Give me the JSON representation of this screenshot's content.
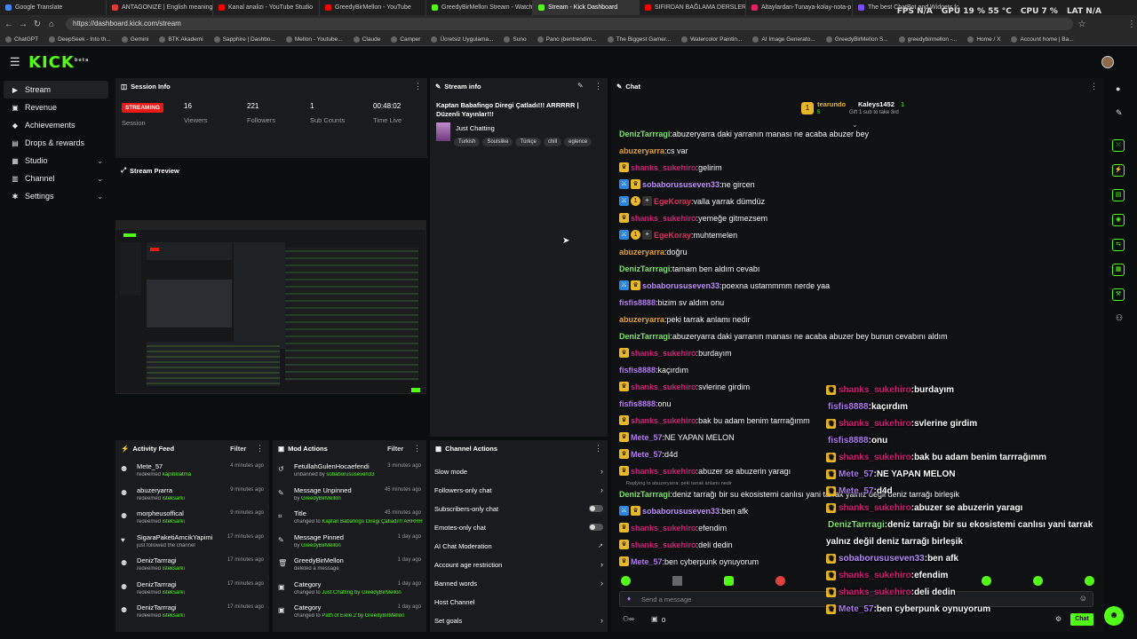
{
  "browser": {
    "tabs": [
      {
        "label": "Google Translate",
        "color": "#4285f4"
      },
      {
        "label": "ANTAGONIZE | English meaning -",
        "color": "#e53935"
      },
      {
        "label": "Kanal analizi - YouTube Studio",
        "color": "#ff0000"
      },
      {
        "label": "GreedyBirMellon - YouTube",
        "color": "#ff0000"
      },
      {
        "label": "GreedyBirMellon Stream - Watch",
        "color": "#53fc18"
      },
      {
        "label": "Stream - Kick Dashboard",
        "color": "#53fc18"
      },
      {
        "label": "SIFIRDAN BAĞLAMA DERSLERİ 6 (",
        "color": "#ff0000"
      },
      {
        "label": "Altaylardan-Tunaya-kolay-nota-p",
        "color": "#e91e63"
      },
      {
        "label": "The best ChatBot and Widgets fo",
        "color": "#7c4dff"
      }
    ],
    "active_tab_index": 5,
    "url": "https://dashboard.kick.com/stream",
    "bookmarks": [
      "ChatGPT",
      "DeepSeek - Into th...",
      "Gemini",
      "BTK Akademi",
      "Sapphire | Dashbo...",
      "Mellon - Youtube...",
      "Claude",
      "Camper",
      "Ücretsiz Uygulama...",
      "Suno",
      "Pano (bentrendim...",
      "The Biggest Gamer...",
      "Watercolor Paintin...",
      "AI Image Generato...",
      "GreedyBirMellon S...",
      "greedybirmellon -...",
      "Home / X",
      "Account home | Ba..."
    ],
    "overlay": {
      "fps": "FPS N/A",
      "gpu": "GPU 19 % 55 °C",
      "cpu": "CPU 7 %",
      "lat": "LAT N/A"
    }
  },
  "app": {
    "logo": "KICK",
    "logo_sup": "beta"
  },
  "sidebar": {
    "items": [
      {
        "label": "Stream",
        "icon": "▶"
      },
      {
        "label": "Revenue",
        "icon": "▣"
      },
      {
        "label": "Achievements",
        "icon": "◆"
      },
      {
        "label": "Drops & rewards",
        "icon": "▤"
      },
      {
        "label": "Studio",
        "icon": "▦"
      },
      {
        "label": "Channel",
        "icon": "▥"
      },
      {
        "label": "Settings",
        "icon": "✱"
      }
    ]
  },
  "session_info": {
    "title": "Session Info",
    "status": "STREAMING",
    "session_label": "Session",
    "stats": [
      {
        "value": "16",
        "label": "Viewers"
      },
      {
        "value": "221",
        "label": "Followers"
      },
      {
        "value": "1",
        "label": "Sub Counts"
      },
      {
        "value": "00:48:02",
        "label": "Time Live"
      }
    ]
  },
  "stream_info": {
    "title": "Stream info",
    "stream_title": "Kaptan Babafingo Diregi Çatladı!!! ARRRRR | Düzenli Yayınlar!!!",
    "category": "Just Chatting",
    "tags": [
      "Turkish",
      "Soulslike",
      "Türkçe",
      "chill",
      "eglence"
    ]
  },
  "preview": {
    "title": "Stream Preview"
  },
  "activity_feed": {
    "title": "Activity Feed",
    "filter": "Filter",
    "items": [
      {
        "name": "Mete_57",
        "action": "redeemed",
        "target": "kapıbklatma",
        "time": "4 minutes ago",
        "icon": "⚉"
      },
      {
        "name": "abuzeryarra",
        "action": "redeemed",
        "target": "isteksarkı",
        "time": "9 minutes ago",
        "icon": "⚉"
      },
      {
        "name": "morpheusoffical",
        "action": "redeemed",
        "target": "isteksarkı",
        "time": "9 minutes ago",
        "icon": "⚉"
      },
      {
        "name": "SigaraPaketiAmcikYapimi",
        "action": "just followed the channel",
        "target": "",
        "time": "17 minutes ago",
        "icon": "♥"
      },
      {
        "name": "DenizTarrragi",
        "action": "redeemed",
        "target": "isteksarkı",
        "time": "17 minutes ago",
        "icon": "⚉"
      },
      {
        "name": "DenizTarrragi",
        "action": "redeemed",
        "target": "isteksarkı",
        "time": "17 minutes ago",
        "icon": "⚉"
      },
      {
        "name": "DenizTarrragi",
        "action": "redeemed",
        "target": "isteksarkı",
        "time": "17 minutes ago",
        "icon": "⚉"
      }
    ]
  },
  "mod_actions": {
    "title": "Mod Actions",
    "filter": "Filter",
    "items": [
      {
        "name": "FetullahGulenHocaefendi",
        "action": "unbanned by",
        "target": "sobaborususeven33",
        "time": "3 minutes ago",
        "icon": "↺"
      },
      {
        "name": "Message Unpinned",
        "action": "by",
        "target": "GreedyBirMellon",
        "time": "45 minutes ago",
        "icon": "✎"
      },
      {
        "name": "Title",
        "action": "changed to",
        "target": "Kaptan Babafingo Diregi Çatladı!!! ARRRRR | Düzenli Yayınlar!!! by GreedyBirMellon",
        "time": "45 minutes ago",
        "icon": "⌗"
      },
      {
        "name": "Message Pinned",
        "action": "by",
        "target": "GreedyBirMellon",
        "time": "1 day ago",
        "icon": "✎"
      },
      {
        "name": "GreedyBirMellon",
        "action": "deleted a message",
        "target": "",
        "time": "1 day ago",
        "icon": "🗑"
      },
      {
        "name": "Category",
        "action": "changed to",
        "target": "Just Chatting by GreedyBirMellon",
        "time": "1 day ago",
        "icon": "▣"
      },
      {
        "name": "Category",
        "action": "changed to",
        "target": "Path of Exile 2 by GreedyBirMellon",
        "time": "1 day ago",
        "icon": "▣"
      }
    ]
  },
  "channel_actions": {
    "title": "Channel Actions",
    "items": [
      {
        "label": "Slow mode",
        "kind": "arrow"
      },
      {
        "label": "Followers-only chat",
        "kind": "arrow"
      },
      {
        "label": "Subscribers-only chat",
        "kind": "toggle"
      },
      {
        "label": "Emotes-only chat",
        "kind": "toggle"
      },
      {
        "label": "AI Chat Moderation",
        "kind": "ext"
      },
      {
        "label": "Account age restriction",
        "kind": "arrow"
      },
      {
        "label": "Banned words",
        "kind": "arrow"
      },
      {
        "label": "Host Channel",
        "kind": "none"
      },
      {
        "label": "Set goals",
        "kind": "arrow"
      }
    ]
  },
  "chat": {
    "title": "Chat",
    "pinned_user": "tearundo",
    "pinned_count": "5",
    "gifter": "Kaleys1452",
    "gifter_count": "1",
    "gift_text": "Gift 1 sub to take 3rd",
    "messages": [
      {
        "user": "DenizTarrragi",
        "text": "abuzeryarra daki yarranın manası ne acaba abuzer bey",
        "color": "#7ee36a",
        "badges": []
      },
      {
        "user": "abuzeryarra",
        "text": "cs var",
        "color": "#e0a23a",
        "badges": []
      },
      {
        "user": "shanks_sukehiro",
        "text": "gelirim",
        "color": "#d1207a",
        "badges": [
          "crown"
        ]
      },
      {
        "user": "sobaborususeven33",
        "text": "ne gircen",
        "color": "#b78cf5",
        "badges": [
          "mod",
          "crown"
        ]
      },
      {
        "user": "EgeKoray",
        "text": "valla yarrak dümdüz",
        "color": "#e02f5e",
        "badges": [
          "mod",
          "one",
          "gift"
        ]
      },
      {
        "user": "shanks_sukehiro",
        "text": "yemeğe gitmezsem",
        "color": "#d1207a",
        "badges": [
          "crown"
        ]
      },
      {
        "user": "EgeKoray",
        "text": "muhtemelen",
        "color": "#e02f5e",
        "badges": [
          "mod",
          "one",
          "gift"
        ]
      },
      {
        "user": "abuzeryarra",
        "text": "doğru",
        "color": "#e0a23a",
        "badges": []
      },
      {
        "user": "DenizTarrragi",
        "text": "tamam ben aldım cevabı",
        "color": "#7ee36a",
        "badges": []
      },
      {
        "user": "sobaborususeven33",
        "text": "poexna ustammmm nerde yaa",
        "color": "#b78cf5",
        "badges": [
          "mod",
          "crown"
        ]
      },
      {
        "user": "fisfis8888",
        "text": "bizim sv aldım onu",
        "color": "#b078f0",
        "badges": []
      },
      {
        "user": "abuzeryarra",
        "text": "peki tarrak anlamı nedir",
        "color": "#e0a23a",
        "badges": []
      },
      {
        "user": "DenizTarrragi",
        "text": "abuzeryarra daki yarranın manası ne acaba abuzer bey bunun cevabını aldım",
        "color": "#7ee36a",
        "badges": []
      },
      {
        "user": "shanks_sukehiro",
        "text": "burdayım",
        "color": "#d1207a",
        "badges": [
          "crown"
        ]
      },
      {
        "user": "fisfis8888",
        "text": "kaçırdım",
        "color": "#b078f0",
        "badges": []
      },
      {
        "user": "shanks_sukehiro",
        "text": "svlerine girdim",
        "color": "#d1207a",
        "badges": [
          "crown"
        ]
      },
      {
        "user": "fisfis8888",
        "text": "onu",
        "color": "#b078f0",
        "badges": []
      },
      {
        "user": "shanks_sukehiro",
        "text": "bak bu adam benim tarrrağımm",
        "color": "#d1207a",
        "badges": [
          "crown"
        ]
      },
      {
        "user": "Mete_57",
        "text": "NE YAPAN MELON",
        "color": "#b078f0",
        "badges": [
          "crown"
        ]
      },
      {
        "user": "Mete_57",
        "text": "d4d",
        "color": "#b078f0",
        "badges": [
          "crown"
        ]
      },
      {
        "user": "shanks_sukehiro",
        "text": "abuzer se abuzerin yaragı",
        "color": "#d1207a",
        "badges": [
          "crown"
        ]
      }
    ],
    "reply_hint": "Replying to abuzeryarra: peki tarrak anlamı nedir",
    "messages2": [
      {
        "user": "DenizTarrragi",
        "text": "deniz tarrağı bir su ekosistemi canlısı yani tarrak yalnız değil deniz tarrağı birleşik",
        "color": "#7ee36a",
        "badges": []
      },
      {
        "user": "sobaborususeven33",
        "text": "ben afk",
        "color": "#b78cf5",
        "badges": [
          "mod",
          "crown"
        ]
      },
      {
        "user": "shanks_sukehiro",
        "text": "efendim",
        "color": "#d1207a",
        "badges": [
          "crown"
        ]
      },
      {
        "user": "shanks_sukehiro",
        "text": "deli dedin",
        "color": "#d1207a",
        "badges": [
          "crown"
        ]
      },
      {
        "user": "Mete_57",
        "text": "ben cyberpunk oynuyorum",
        "color": "#b078f0",
        "badges": [
          "crown"
        ]
      }
    ],
    "input_placeholder": "Send a message",
    "send_label": "Chat",
    "viewer_count": "0"
  },
  "overlay_chat": [
    {
      "user": "shanks_sukehiro",
      "text": "burdayım",
      "color": "#d1207a",
      "crown": true
    },
    {
      "user": "fisfis8888",
      "text": "kaçırdım",
      "color": "#b078f0",
      "crown": false
    },
    {
      "user": "shanks_sukehiro",
      "text": "svlerine girdim",
      "color": "#d1207a",
      "crown": true
    },
    {
      "user": "fisfis8888",
      "text": "onu",
      "color": "#b078f0",
      "crown": false
    },
    {
      "user": "shanks_sukehiro",
      "text": "bak bu adam benim tarrrağımm",
      "color": "#d1207a",
      "crown": true
    },
    {
      "user": "Mete_57",
      "text": "NE YAPAN MELON",
      "color": "#b078f0",
      "crown": true
    },
    {
      "user": "Mete_57",
      "text": "d4d",
      "color": "#b078f0",
      "crown": true
    },
    {
      "user": "shanks_sukehiro",
      "text": "abuzer se abuzerin yaragı",
      "color": "#d1207a",
      "crown": true
    },
    {
      "user": "DenizTarrragi",
      "text": "deniz tarrağı bir su ekosistemi canlısı yani tarrak",
      "color": "#7ee36a",
      "crown": false
    },
    {
      "user": "",
      "text": "yalnız değil deniz tarrağı birleşik",
      "color": "#fff",
      "crown": false
    },
    {
      "user": "sobaborususeven33",
      "text": "ben afk",
      "color": "#b78cf5",
      "crown": true
    },
    {
      "user": "shanks_sukehiro",
      "text": "efendim",
      "color": "#d1207a",
      "crown": true
    },
    {
      "user": "shanks_sukehiro",
      "text": "deli dedin",
      "color": "#d1207a",
      "crown": true
    },
    {
      "user": "Mete_57",
      "text": "ben cyberpunk oynuyorum",
      "color": "#b078f0",
      "crown": true
    }
  ],
  "colors": {
    "accent": "#53fc18",
    "live": "#e91916",
    "panel": "#191b1f",
    "bg": "#0b0e0f"
  }
}
